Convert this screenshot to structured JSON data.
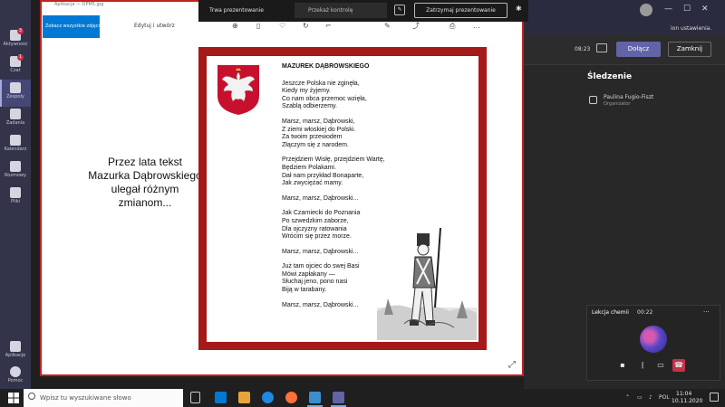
{
  "rail": {
    "items": [
      {
        "label": "Aktywność",
        "badge": "3"
      },
      {
        "label": "Czat",
        "badge": "1"
      },
      {
        "label": "Zespoły",
        "badge": ""
      },
      {
        "label": "Zadania",
        "badge": ""
      },
      {
        "label": "Kalendarz",
        "badge": ""
      },
      {
        "label": "Rozmowy",
        "badge": ""
      },
      {
        "label": "Pliki",
        "badge": ""
      },
      {
        "label": "Aplikacje",
        "badge": ""
      },
      {
        "label": "Pomoc",
        "badge": ""
      }
    ]
  },
  "teams": {
    "notice": "ion ustawienia.",
    "meeting_time": "08:23",
    "join_label": "Dołącz",
    "close_label": "Zamknij",
    "panel_title": "Śledzenie",
    "follow_name": "Paulina Fugio-Fiszt",
    "follow_role": "Organizator"
  },
  "mini_call": {
    "title": "Lekcja chemii",
    "time": "00:22",
    "more": "..."
  },
  "photos": {
    "window_title": "Aplikacja — DPM5.jpg",
    "see_all_label": "Zobacz wszystkie zdjęcia",
    "edit_label": "Edytuj i utwórz"
  },
  "presenter": {
    "label": "Trwa prezentowanie",
    "control_label": "Przekaż kontrolę",
    "stop_label": "Zatrzymaj prezentowanie"
  },
  "slide": {
    "caption": "Przez lata tekst Mazurka Dąbrowskiego ulegał różnym zmianom...",
    "poem_title": "MAZUREK DĄBROWSKIEGO",
    "stanzas": [
      [
        "Jeszcze Polska nie zginęła,",
        "Kiedy my żyjemy.",
        "Co nam obca przemoc wzięła,",
        "Szablą odbierzemy."
      ],
      [
        "Marsz, marsz, Dąbrowski,",
        "Z ziemi włoskiej do Polski.",
        "Za twoim przewodem",
        "Złączym się z narodem."
      ],
      [
        "Przejdziem Wisłę, przejdziem Wartę,",
        "Będziem Polakami.",
        "Dał nam przykład Bonaparte,",
        "Jak zwyciężać mamy."
      ],
      [
        "Marsz, marsz, Dąbrowski..."
      ],
      [
        "Jak Czarniecki do Poznania",
        "Po szwedzkim zaborze,",
        "Dla ojczyzny ratowania",
        "Wrócim się przez morze."
      ],
      [
        "Marsz, marsz, Dąbrowski..."
      ],
      [
        "Już tam ojciec do swej Basi",
        "Mówi zapłakany —",
        "Słuchaj jeno, pono nasi",
        "Biją w tarabany."
      ],
      [
        "Marsz, marsz, Dąbrowski..."
      ]
    ]
  },
  "taskbar": {
    "search_placeholder": "Wpisz tu wyszukiwane słowo",
    "time": "11:04",
    "date": "10.11.2020",
    "lang": "POL"
  },
  "colors": {
    "teams_purple": "#6264a7",
    "share_border": "#c32020",
    "poem_frame": "#a61919",
    "hangup": "#c4314b"
  }
}
